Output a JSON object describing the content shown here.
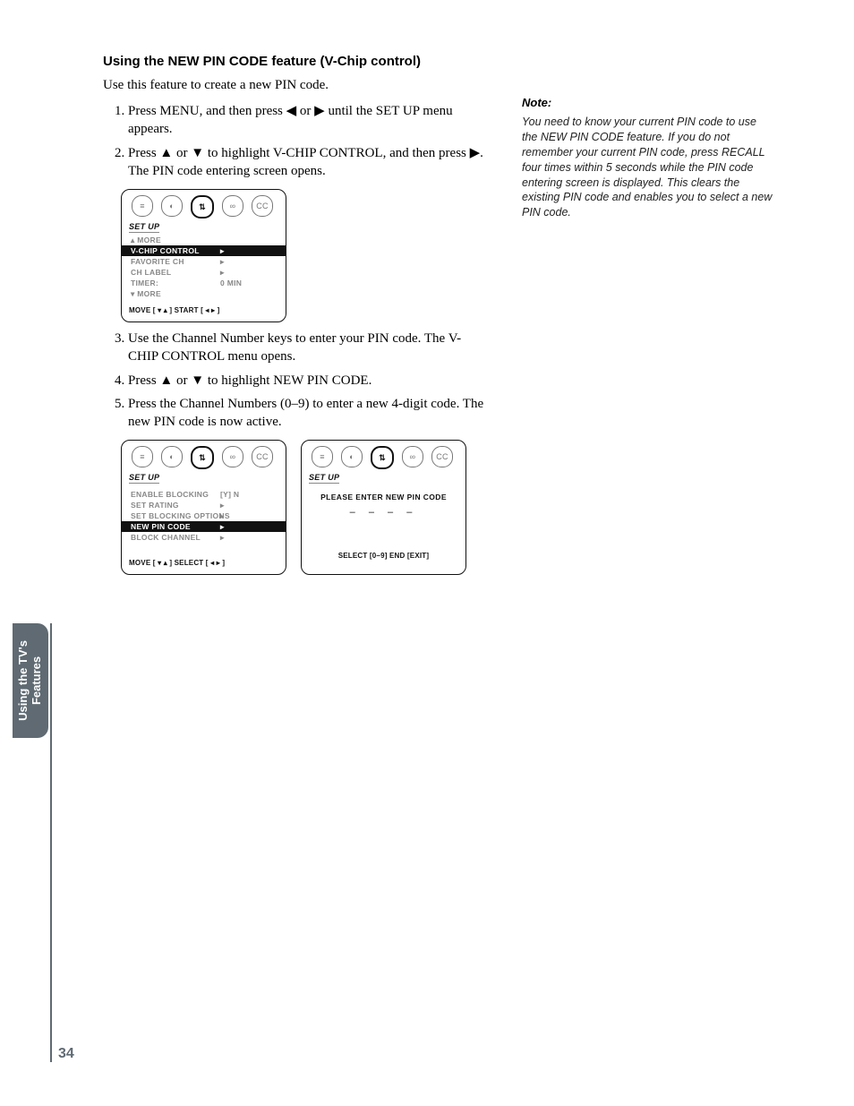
{
  "heading": "Using the NEW PIN CODE feature (V-Chip control)",
  "intro": "Use this feature to create a new PIN code.",
  "steps_a": [
    "Press MENU, and then press ◀ or ▶ until the SET UP menu appears.",
    "Press ▲ or ▼ to highlight V-CHIP CONTROL, and then press ▶. The PIN code entering screen opens."
  ],
  "steps_b": [
    "Use the Channel Number keys to enter your PIN code. The V-CHIP CONTROL menu opens.",
    "Press ▲ or ▼ to highlight NEW PIN CODE.",
    "Press the Channel Numbers (0–9) to enter a new 4-digit code. The new PIN code is now active."
  ],
  "note_title": "Note:",
  "note_body": "You need to know your current PIN code to use the NEW PIN CODE feature. If you do not remember your current PIN code, press RECALL four times within 5 seconds while the PIN code entering screen is displayed. This clears the existing PIN code and enables you to select a new PIN code.",
  "osd": {
    "setup_label": "SET UP",
    "icons": [
      "≡",
      "◐",
      "⇅",
      "∞",
      "CC"
    ],
    "menu1": {
      "more_up": "▴ MORE",
      "rows": [
        {
          "k": "V-CHIP CONTROL",
          "v": "▸",
          "hl": true
        },
        {
          "k": "FAVORITE CH",
          "v": "▸"
        },
        {
          "k": "CH LABEL",
          "v": "▸"
        },
        {
          "k": "TIMER:",
          "v": "0 MIN"
        }
      ],
      "more_down": "▾ MORE",
      "footer": "MOVE [ ▾ ▴ ]     START [ ◂  ▸ ]"
    },
    "menu2": {
      "rows": [
        {
          "k": "ENABLE BLOCKING",
          "v": "[Y] N"
        },
        {
          "k": "SET RATING",
          "v": "▸"
        },
        {
          "k": "SET BLOCKING OPTIONS",
          "v": "▸"
        },
        {
          "k": "NEW PIN CODE",
          "v": "▸",
          "hl": true
        },
        {
          "k": "BLOCK CHANNEL",
          "v": "▸"
        }
      ],
      "footer": "MOVE [ ▾ ▴ ]     SELECT [ ◂  ▸ ]"
    },
    "menu3": {
      "prompt": "PLEASE ENTER NEW PIN CODE",
      "blanks": "– – – –",
      "footer": "SELECT [0–9]   END [EXIT]"
    }
  },
  "side_tab_l1": "Using the TV's",
  "side_tab_l2": "Features",
  "page_number": "34"
}
